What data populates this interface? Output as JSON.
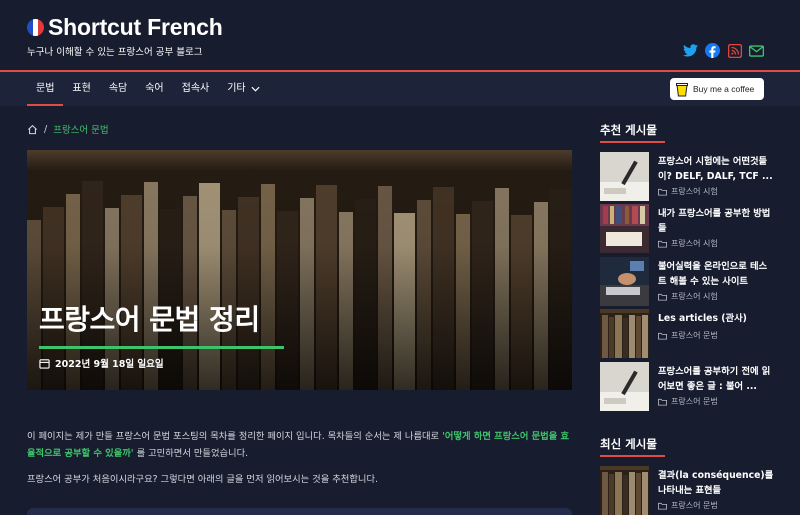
{
  "site": {
    "title": "Shortcut French",
    "tagline": "누구나 이해할 수 있는 프랑스어 공부 블로그",
    "flag_colors": [
      "#1f4fc2",
      "#ffffff",
      "#e23a3a"
    ]
  },
  "social": [
    {
      "name": "twitter-icon",
      "color": "#1da1f2"
    },
    {
      "name": "facebook-icon",
      "color": "#1877f2"
    },
    {
      "name": "rss-icon",
      "color": "#e0463c"
    },
    {
      "name": "mail-icon",
      "color": "#3fc36a"
    }
  ],
  "nav": {
    "items": [
      {
        "label": "문법",
        "active": true
      },
      {
        "label": "표현",
        "active": false
      },
      {
        "label": "속담",
        "active": false
      },
      {
        "label": "숙어",
        "active": false
      },
      {
        "label": "접속사",
        "active": false
      },
      {
        "label": "기타",
        "active": false,
        "dropdown": true
      }
    ],
    "coffee_label": "Buy me a coffee"
  },
  "breadcrumb": {
    "separator": "/",
    "current": "프랑스어 문법"
  },
  "hero": {
    "title": "프랑스어 문법 정리",
    "date": "2022년 9월 18일 일요일"
  },
  "article": {
    "p1_start": "이 페이지는 제가 만들 프랑스어 문법 포스팅의 목차를 정리한 페이지 입니다. 목차들의 순서는 제 나름대로 ",
    "p1_highlight": "'어떻게 하면 프랑스어 문법을 효율적으로 공부할 수 있을까'",
    "p1_end": " 를 고민하면서 만들었습니다.",
    "p2": "프랑스어 공부가 처음이시라구요? 그렇다면 아래의 글을 먼저 읽어보시는 것을 추천합니다."
  },
  "sidebar": {
    "recommended_heading": "추천 게시물",
    "recommended": [
      {
        "title": "프랑스어 시험에는 어떤것들이? DELF, DALF, TCF ...",
        "category": "프랑스어 시험"
      },
      {
        "title": "내가 프랑스어를 공부한 방법들",
        "category": "프랑스어 시험"
      },
      {
        "title": "불어실력을 온라인으로 테스트 해볼 수 있는 사이트",
        "category": "프랑스어 시험"
      },
      {
        "title": "Les articles (관사)",
        "category": "프랑스어 문법"
      },
      {
        "title": "프랑스어를 공부하기 전에 읽어보면 좋은 글 : 불어 ...",
        "category": "프랑스어 문법"
      }
    ],
    "latest_heading": "최신 게시물",
    "latest": [
      {
        "title": "결과(la conséquence)를 나타내는 표현들",
        "category": "프랑스어 문법"
      }
    ]
  },
  "colors": {
    "background": "#171c2e",
    "nav": "#1d2338",
    "accent_red": "#e04b43",
    "accent_green": "#3fc36a"
  }
}
